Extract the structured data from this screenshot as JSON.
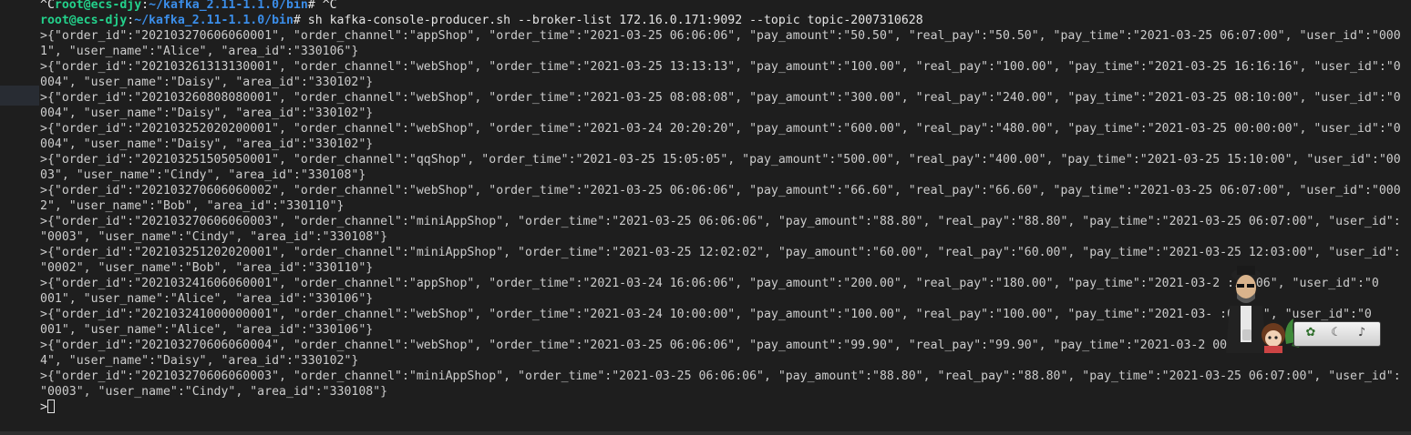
{
  "terminal": {
    "line0": {
      "ctrlc": "^C",
      "user": "root@ecs-djy",
      "sep": ":",
      "path": "~/kafka_2.11-1.1.0/bin",
      "prompt": "# ",
      "tail": "^C"
    },
    "line1": {
      "user": "root@ecs-djy",
      "sep": ":",
      "path": "~/kafka_2.11-1.1.0/bin",
      "prompt": "# ",
      "command": "sh kafka-console-producer.sh --broker-list 172.16.0.171:9092 --topic topic-2007310628"
    },
    "output": [
      ">{\"order_id\":\"202103270606060001\", \"order_channel\":\"appShop\", \"order_time\":\"2021-03-25 06:06:06\", \"pay_amount\":\"50.50\", \"real_pay\":\"50.50\", \"pay_time\":\"2021-03-25 06:07:00\", \"user_id\":\"000",
      "1\", \"user_name\":\"Alice\", \"area_id\":\"330106\"}",
      ">{\"order_id\":\"202103261313130001\", \"order_channel\":\"webShop\", \"order_time\":\"2021-03-25 13:13:13\", \"pay_amount\":\"100.00\", \"real_pay\":\"100.00\", \"pay_time\":\"2021-03-25 16:16:16\", \"user_id\":\"0",
      "004\", \"user_name\":\"Daisy\", \"area_id\":\"330102\"}",
      ">{\"order_id\":\"202103260808080001\", \"order_channel\":\"webShop\", \"order_time\":\"2021-03-25 08:08:08\", \"pay_amount\":\"300.00\", \"real_pay\":\"240.00\", \"pay_time\":\"2021-03-25 08:10:00\", \"user_id\":\"0",
      "004\", \"user_name\":\"Daisy\", \"area_id\":\"330102\"}",
      ">{\"order_id\":\"202103252020200001\", \"order_channel\":\"webShop\", \"order_time\":\"2021-03-24 20:20:20\", \"pay_amount\":\"600.00\", \"real_pay\":\"480.00\", \"pay_time\":\"2021-03-25 00:00:00\", \"user_id\":\"0",
      "004\", \"user_name\":\"Daisy\", \"area_id\":\"330102\"}",
      ">{\"order_id\":\"202103251505050001\", \"order_channel\":\"qqShop\", \"order_time\":\"2021-03-25 15:05:05\", \"pay_amount\":\"500.00\", \"real_pay\":\"400.00\", \"pay_time\":\"2021-03-25 15:10:00\", \"user_id\":\"00",
      "03\", \"user_name\":\"Cindy\", \"area_id\":\"330108\"}",
      ">{\"order_id\":\"202103270606060002\", \"order_channel\":\"webShop\", \"order_time\":\"2021-03-25 06:06:06\", \"pay_amount\":\"66.60\", \"real_pay\":\"66.60\", \"pay_time\":\"2021-03-25 06:07:00\", \"user_id\":\"000",
      "2\", \"user_name\":\"Bob\", \"area_id\":\"330110\"}",
      ">{\"order_id\":\"202103270606060003\", \"order_channel\":\"miniAppShop\", \"order_time\":\"2021-03-25 06:06:06\", \"pay_amount\":\"88.80\", \"real_pay\":\"88.80\", \"pay_time\":\"2021-03-25 06:07:00\", \"user_id\":",
      "\"0003\", \"user_name\":\"Cindy\", \"area_id\":\"330108\"}",
      ">{\"order_id\":\"202103251202020001\", \"order_channel\":\"miniAppShop\", \"order_time\":\"2021-03-25 12:02:02\", \"pay_amount\":\"60.00\", \"real_pay\":\"60.00\", \"pay_time\":\"2021-03-25 12:03:00\", \"user_id\":",
      "\"0002\", \"user_name\":\"Bob\", \"area_id\":\"330110\"}",
      ">{\"order_id\":\"202103241606060001\", \"order_channel\":\"appShop\", \"order_time\":\"2021-03-24 16:06:06\", \"pay_amount\":\"200.00\", \"real_pay\":\"180.00\", \"pay_time\":\"2021-03-2 :10:06\", \"user_id\":\"0",
      "001\", \"user_name\":\"Alice\", \"area_id\":\"330106\"}",
      ">{\"order_id\":\"202103241000000001\", \"order_channel\":\"webShop\", \"order_time\":\"2021-03-24 10:00:00\", \"pay_amount\":\"100.00\", \"real_pay\":\"100.00\", \"pay_time\":\"2021-03- :02:03\", \"user_id\":\"0",
      "001\", \"user_name\":\"Alice\", \"area_id\":\"330106\"}",
      ">{\"order_id\":\"202103270606060004\", \"order_channel\":\"webShop\", \"order_time\":\"2021-03-25 06:06:06\", \"pay_amount\":\"99.90\", \"real_pay\":\"99.90\", \"pay_time\":\"2021-03-2 000",
      "4\", \"user_name\":\"Daisy\", \"area_id\":\"330102\"}",
      ">{\"order_id\":\"202103270606060003\", \"order_channel\":\"miniAppShop\", \"order_time\":\"2021-03-25 06:06:06\", \"pay_amount\":\"88.80\", \"real_pay\":\"88.80\", \"pay_time\":\"2021-03-25 06:07:00\", \"user_id\":",
      "\"0003\", \"user_name\":\"Cindy\", \"area_id\":\"330108\"}"
    ],
    "input_prompt": ">"
  },
  "colors": {
    "background": "#1e1e1e",
    "prompt_user": "#23d18b",
    "prompt_path": "#3b8eea",
    "text": "#cccccc"
  },
  "widget": {
    "icons": [
      "character-mascot-icon",
      "plant-icon",
      "moon-icon",
      "music-note-icon"
    ]
  }
}
